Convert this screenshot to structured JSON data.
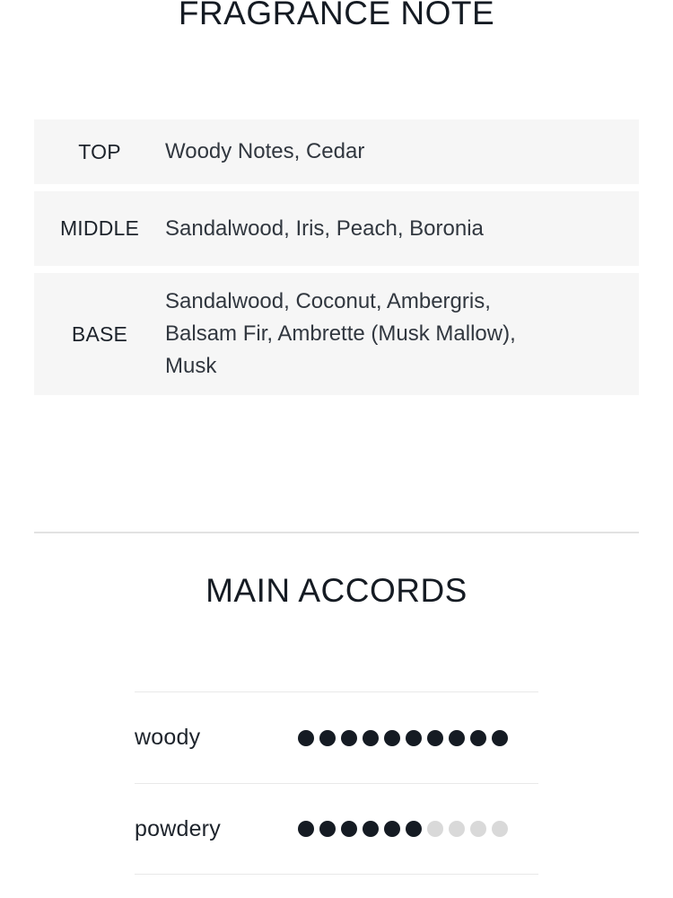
{
  "fragrance_note": {
    "heading": "FRAGRANCE NOTE",
    "rows": [
      {
        "label": "TOP",
        "value": "Woody Notes, Cedar"
      },
      {
        "label": "MIDDLE",
        "value": "Sandalwood, Iris, Peach, Boronia"
      },
      {
        "label": "BASE",
        "value": "Sandalwood, Coconut, Ambergris,\nBalsam Fir, Ambrette (Musk Mallow),\nMusk"
      }
    ]
  },
  "main_accords": {
    "heading": "MAIN ACCORDS",
    "scale_max": 10,
    "items": [
      {
        "name": "woody",
        "filled": 10
      },
      {
        "name": "powdery",
        "filled": 6
      }
    ]
  },
  "colors": {
    "text": "#151b23",
    "row_background": "#f6f6f6",
    "divider": "#e2e2e2",
    "dot_filled": "#151b23",
    "dot_empty": "#d9d9d9"
  }
}
